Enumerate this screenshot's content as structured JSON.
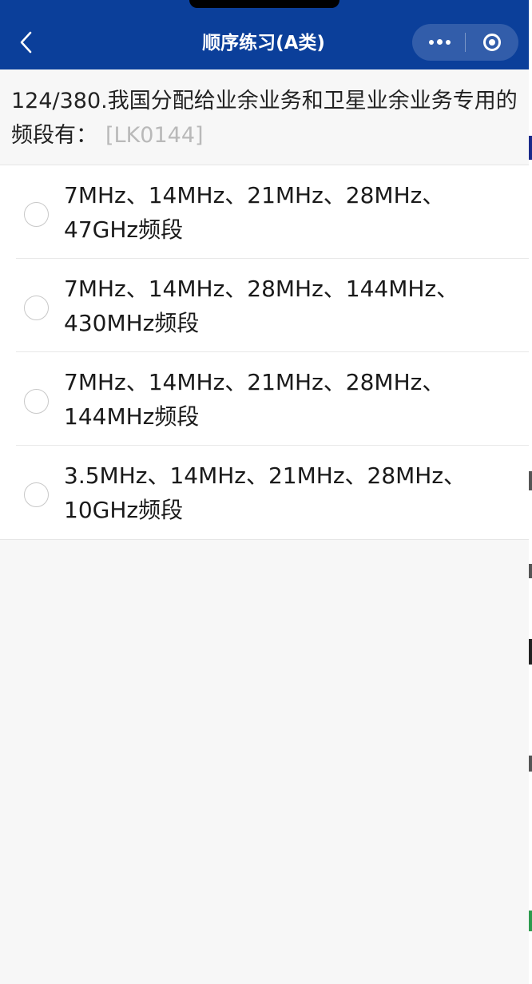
{
  "navbar": {
    "title": "顺序练习(A类)",
    "back_icon": "chevron-left-icon",
    "more_icon": "more-dots-icon",
    "close_icon": "target-close-icon",
    "color": "#0b3f9a"
  },
  "question": {
    "number": "124/380.",
    "text": "我国分配给业余业务和卫星业余业务专用的频段有：",
    "code": "[LK0144]"
  },
  "options": [
    {
      "line1": "7MHz、14MHz、21MHz、28MHz、",
      "line2": "47GHz频段"
    },
    {
      "line1": "7MHz、14MHz、28MHz、144MHz、",
      "line2": "430MHz频段"
    },
    {
      "line1": "7MHz、14MHz、21MHz、28MHz、",
      "line2": "144MHz频段"
    },
    {
      "line1": "3.5MHz、14MHz、21MHz、28MHz、",
      "line2": "10GHz频段"
    }
  ]
}
